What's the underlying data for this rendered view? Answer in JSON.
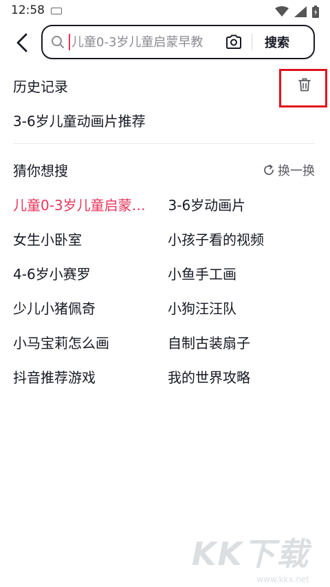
{
  "status_bar": {
    "time": "12:58",
    "icons": [
      "keyboard-icon",
      "wifi-icon",
      "signal-icon",
      "battery-icon"
    ]
  },
  "search": {
    "back_icon": "chevron-left-icon",
    "placeholder": "儿童0-3岁儿童启蒙早教",
    "value": "",
    "camera_icon": "camera-icon",
    "submit_label": "搜索"
  },
  "history": {
    "title": "历史记录",
    "clear_icon": "trash-icon",
    "items": [
      "3-6岁儿童动画片推荐"
    ]
  },
  "guess": {
    "title": "猜你想搜",
    "refresh_label": "换一换",
    "items": [
      [
        "儿童0-3岁儿童启蒙早教",
        "3-6岁动画片"
      ],
      [
        "女生小卧室",
        "小孩子看的视频"
      ],
      [
        "4-6岁小赛罗",
        "小鱼手工画"
      ],
      [
        "少儿小猪佩奇",
        "小狗汪汪队"
      ],
      [
        "小马宝莉怎么画",
        "自制古装扇子"
      ],
      [
        "抖音推荐游戏",
        "我的世界攻略"
      ]
    ]
  },
  "watermark": {
    "text": "KK下载",
    "url": "www.kkx.net"
  },
  "colors": {
    "accent": "#fe2c55",
    "hot_text": "#e8345a",
    "highlight_box": "#e0121b",
    "text_primary": "#161823",
    "text_secondary": "#8a8b91"
  }
}
